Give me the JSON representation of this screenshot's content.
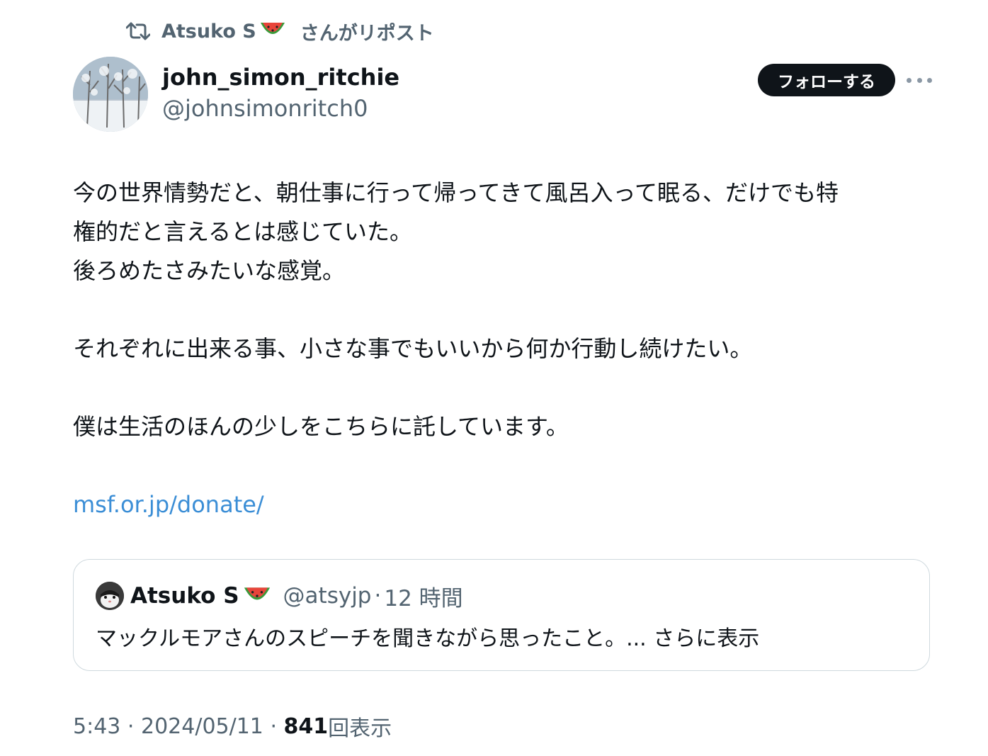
{
  "repost": {
    "name": "Atsuko S",
    "suffix": "さんがリポスト"
  },
  "author": {
    "display_name": "john_simon_ritchie",
    "handle": "@johnsimonritch0"
  },
  "actions": {
    "follow_label": "フォローする"
  },
  "tweet": {
    "lines": [
      "今の世界情勢だと、朝仕事に行って帰ってきて風呂入って眠る、だけでも特",
      "権的だと言えるとは感じていた。",
      "後ろめたさみたいな感覚。",
      "それぞれに出来る事、小さな事でもいいから何か行動し続けたい。",
      "僕は生活のほんの少しをこちらに託しています。"
    ],
    "link": "msf.or.jp/donate/"
  },
  "quote": {
    "name": "Atsuko S",
    "handle": "@atsyjp",
    "separator": "·",
    "time": "12 時間",
    "text": "マックルモアさんのスピーチを聞きながら思ったこと。... さらに表示"
  },
  "meta": {
    "time": "5:43",
    "separator1": " · ",
    "date": "2024/05/11",
    "separator2": " · ",
    "views": "841",
    "views_label": "回表示"
  },
  "colors": {
    "link": "#3b8ed6",
    "secondary_text": "#536471",
    "primary_text": "#0f1419",
    "follow_bg": "#0f1419"
  },
  "icons": {
    "repost": "repost-icon",
    "emoji": "watermelon-icon",
    "more": "more-icon"
  }
}
